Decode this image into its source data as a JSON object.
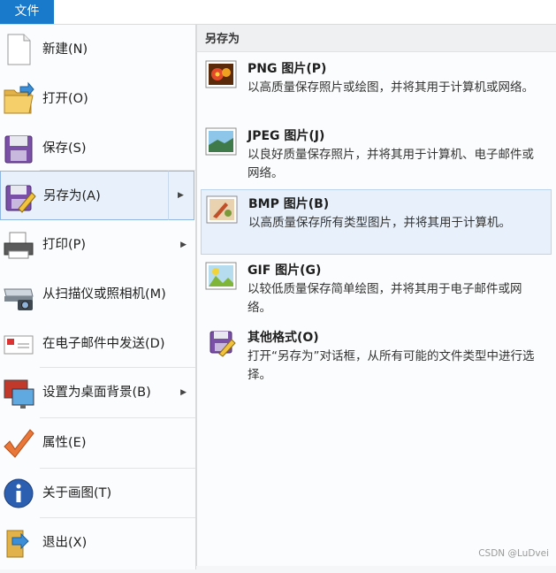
{
  "file_tab": "文件",
  "left_menu": [
    {
      "label": "新建(N)"
    },
    {
      "label": "打开(O)"
    },
    {
      "label": "保存(S)"
    },
    {
      "label": "另存为(A)"
    },
    {
      "label": "打印(P)"
    },
    {
      "label": "从扫描仪或照相机(M)"
    },
    {
      "label": "在电子邮件中发送(D)"
    },
    {
      "label": "设置为桌面背景(B)"
    },
    {
      "label": "属性(E)"
    },
    {
      "label": "关于画图(T)"
    },
    {
      "label": "退出(X)"
    }
  ],
  "submenu": {
    "header": "另存为",
    "options": [
      {
        "title": "PNG 图片(P)",
        "desc": "以高质量保存照片或绘图，并将其用于计算机或网络。"
      },
      {
        "title": "JPEG 图片(J)",
        "desc": "以良好质量保存照片，并将其用于计算机、电子邮件或网络。"
      },
      {
        "title": "BMP 图片(B)",
        "desc": "以高质量保存所有类型图片，并将其用于计算机。"
      },
      {
        "title": "GIF 图片(G)",
        "desc": "以较低质量保存简单绘图，并将其用于电子邮件或网络。"
      },
      {
        "title": "其他格式(O)",
        "desc": "打开“另存为”对话框，从所有可能的文件类型中进行选择。"
      }
    ]
  },
  "watermark": "CSDN @LuDvei",
  "colors": {
    "file_tab": "#1979ca",
    "hover": "#e8f1fb",
    "hover_border": "#8fb6e0"
  }
}
